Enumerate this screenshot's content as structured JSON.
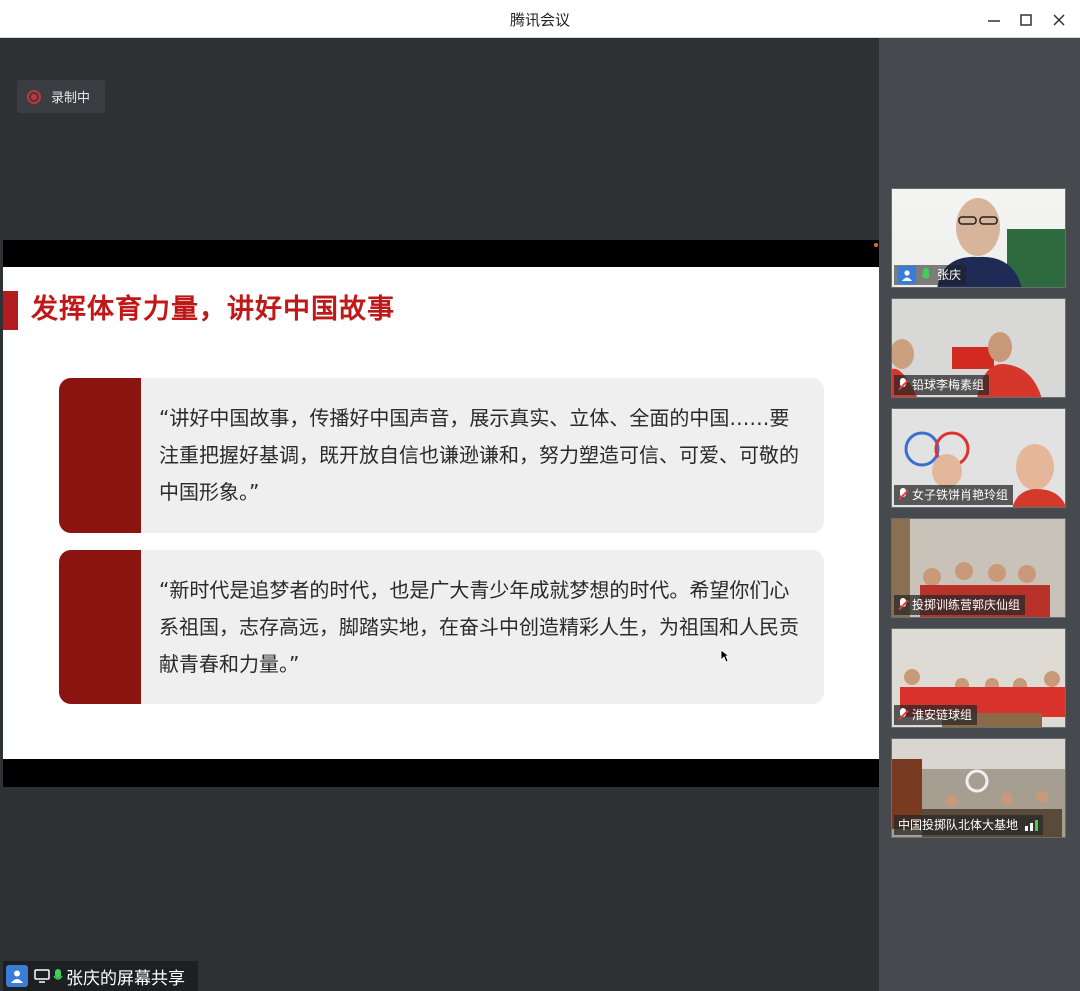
{
  "window": {
    "title": "腾讯会议"
  },
  "recording": {
    "label": "录制中"
  },
  "slide": {
    "title": "发挥体育力量，讲好中国故事",
    "quotes": [
      {
        "text": "“讲好中国故事，传播好中国声音，展示真实、立体、全面的中国……要注重把握好基调，既开放自信也谦逊谦和，努力塑造可信、可爱、可敬的中国形象。”"
      },
      {
        "text": "“新时代是追梦者的时代，也是广大青少年成就梦想的时代。希望你们心系祖国，志存高远，脚踏实地，在奋斗中创造精彩人生，为祖国和人民贡献青春和力量。”"
      }
    ]
  },
  "participants": [
    {
      "name": "张庆",
      "mic": "on",
      "host": true
    },
    {
      "name": "铅球李梅素组",
      "mic": "off"
    },
    {
      "name": "女子铁饼肖艳玲组",
      "mic": "off"
    },
    {
      "name": "投掷训练营郭庆仙组",
      "mic": "off"
    },
    {
      "name": "淮安链球组",
      "mic": "off"
    },
    {
      "name": "中国投掷队北体大基地",
      "mic": "signal"
    }
  ],
  "share": {
    "label": "张庆的屏幕共享"
  },
  "colors": {
    "accent_red": "#b21e1e",
    "quote_side": "#8b1310"
  }
}
